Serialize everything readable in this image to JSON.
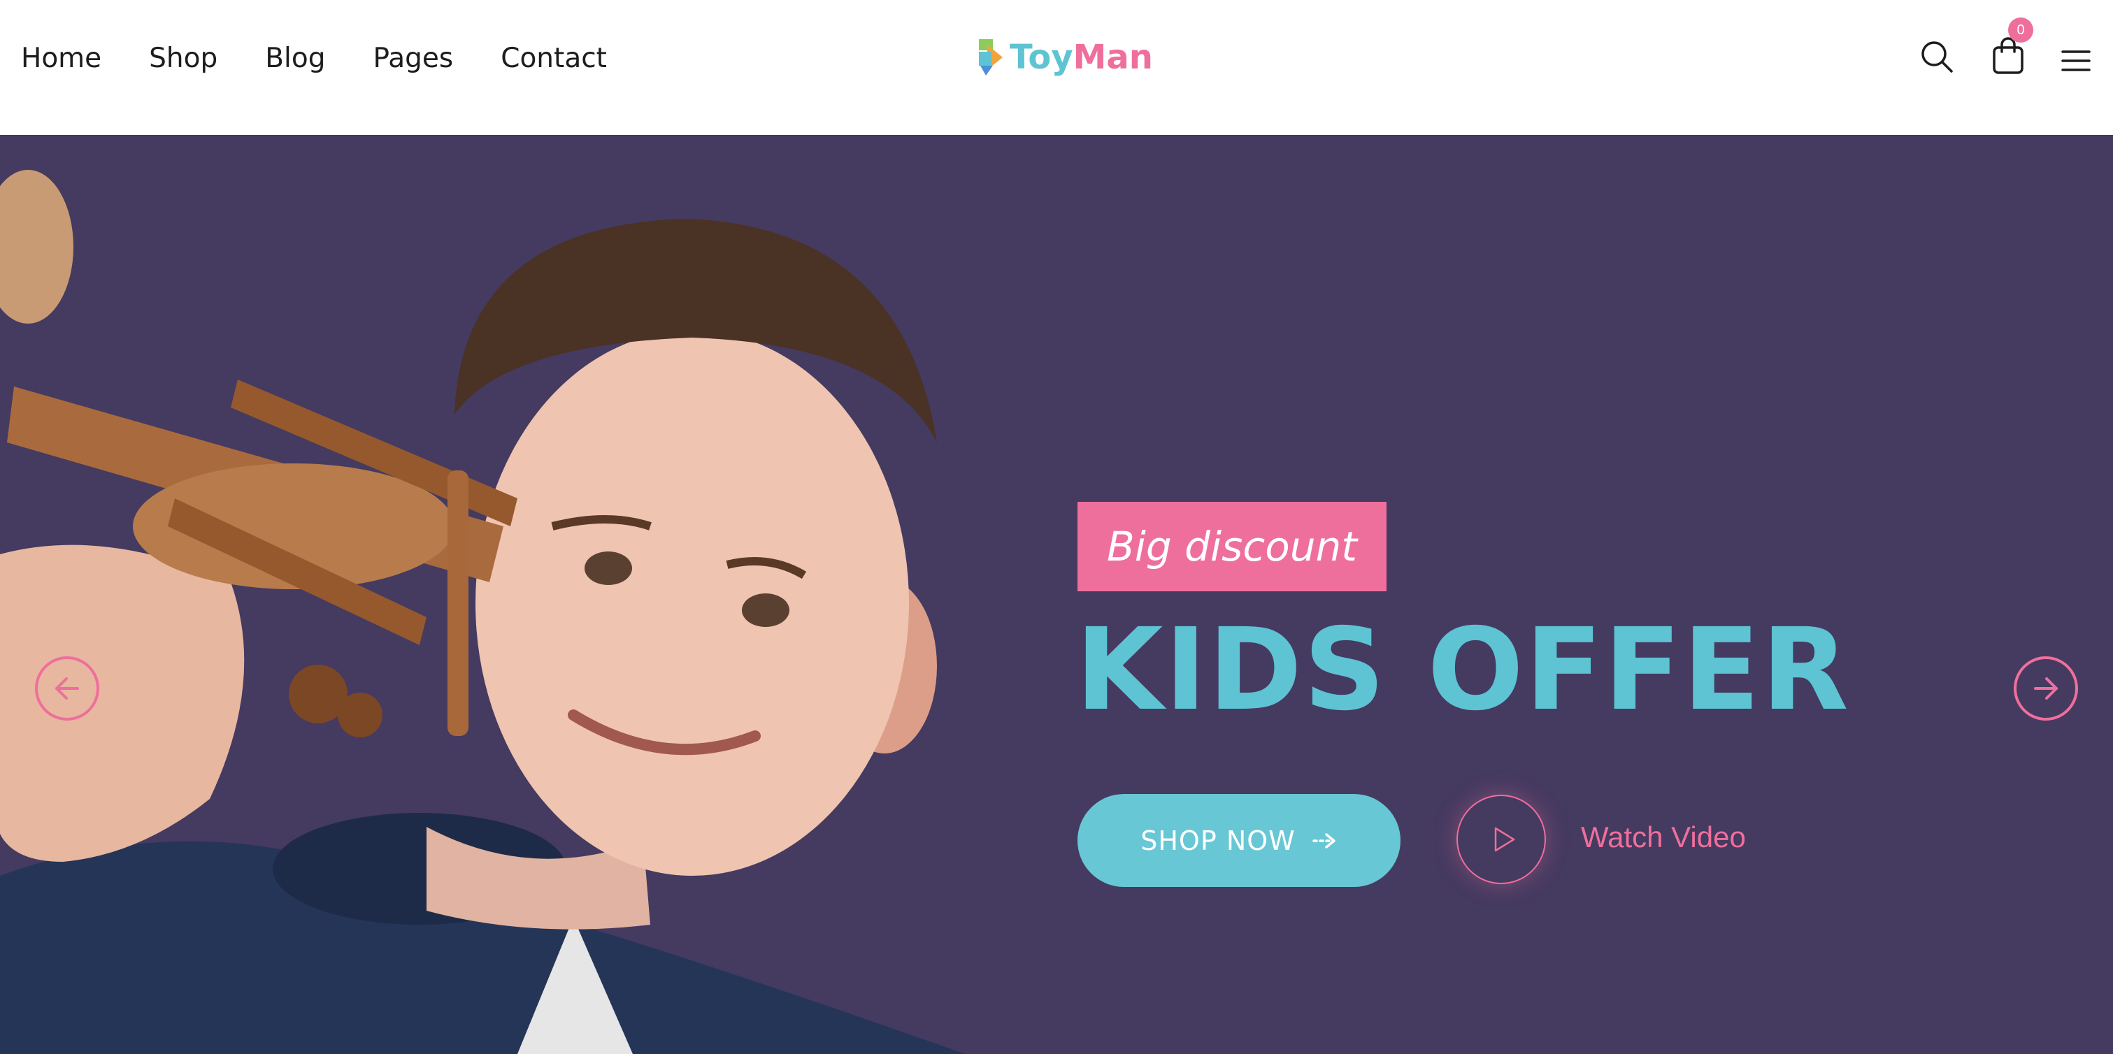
{
  "nav": {
    "items": [
      {
        "label": "Home"
      },
      {
        "label": "Shop"
      },
      {
        "label": "Blog"
      },
      {
        "label": "Pages"
      },
      {
        "label": "Contact"
      }
    ]
  },
  "logo": {
    "part1": "Toy",
    "part2": "Man",
    "icon": "puzzle-arrow-logo-icon"
  },
  "header_icons": {
    "search": "search-icon",
    "cart": "shopping-bag-icon",
    "menu": "hamburger-menu-icon"
  },
  "cart": {
    "count": "0"
  },
  "hero": {
    "badge": "Big discount",
    "headline": "KIDS OFFER",
    "cta_label": "SHOP NOW",
    "cta_icon": "arrow-right-icon",
    "video_label": "Watch Video",
    "video_icon": "play-icon",
    "prev_icon": "arrow-left-circle-icon",
    "next_icon": "arrow-right-circle-icon"
  },
  "colors": {
    "hero_bg": "#453a60",
    "accent_pink": "#ef6f9c",
    "accent_teal": "#5ec3d2",
    "text_dark": "#1d1d1d"
  }
}
